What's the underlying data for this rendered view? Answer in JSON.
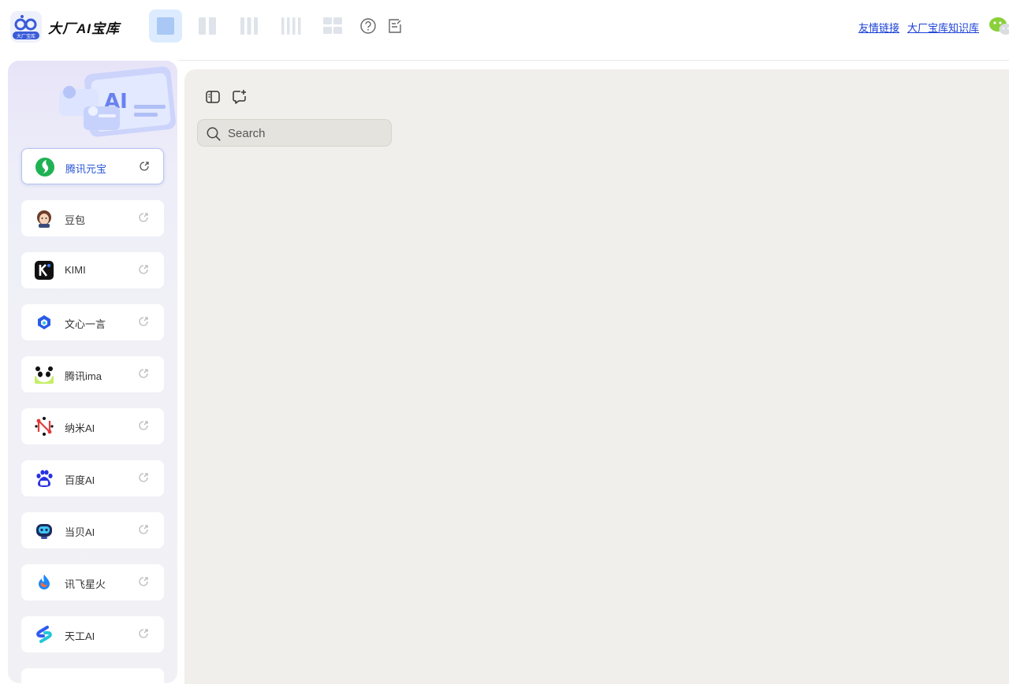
{
  "header": {
    "brand": "大厂AI宝库",
    "logo_badge": "大厂宝库",
    "layout_modes": [
      "single-column",
      "two-column",
      "three-column",
      "four-column",
      "grid"
    ],
    "tools": [
      "help-icon",
      "feedback-icon"
    ],
    "links": [
      {
        "label": "友情链接"
      },
      {
        "label": "大厂宝库知识库"
      }
    ]
  },
  "sidebar": {
    "banner_text": "AI",
    "items": [
      {
        "label": "腾讯元宝",
        "icon": "yuanbao-icon",
        "active": true
      },
      {
        "label": "豆包",
        "icon": "doubao-icon",
        "active": false
      },
      {
        "label": "KIMI",
        "icon": "kimi-icon",
        "active": false
      },
      {
        "label": "文心一言",
        "icon": "wenxin-icon",
        "active": false
      },
      {
        "label": "腾讯ima",
        "icon": "ima-icon",
        "active": false
      },
      {
        "label": "纳米AI",
        "icon": "nami-icon",
        "active": false
      },
      {
        "label": "百度AI",
        "icon": "baidu-icon",
        "active": false
      },
      {
        "label": "当贝AI",
        "icon": "dangbei-icon",
        "active": false
      },
      {
        "label": "讯飞星火",
        "icon": "xinghuo-icon",
        "active": false
      },
      {
        "label": "天工AI",
        "icon": "tiangong-icon",
        "active": false
      }
    ]
  },
  "main": {
    "search": {
      "placeholder": "Search",
      "value": ""
    }
  },
  "colors": {
    "accent": "#2a56d8",
    "active_layout_bg": "#dcebff",
    "main_bg": "#f0efeb",
    "link": "#1a3fd6"
  }
}
